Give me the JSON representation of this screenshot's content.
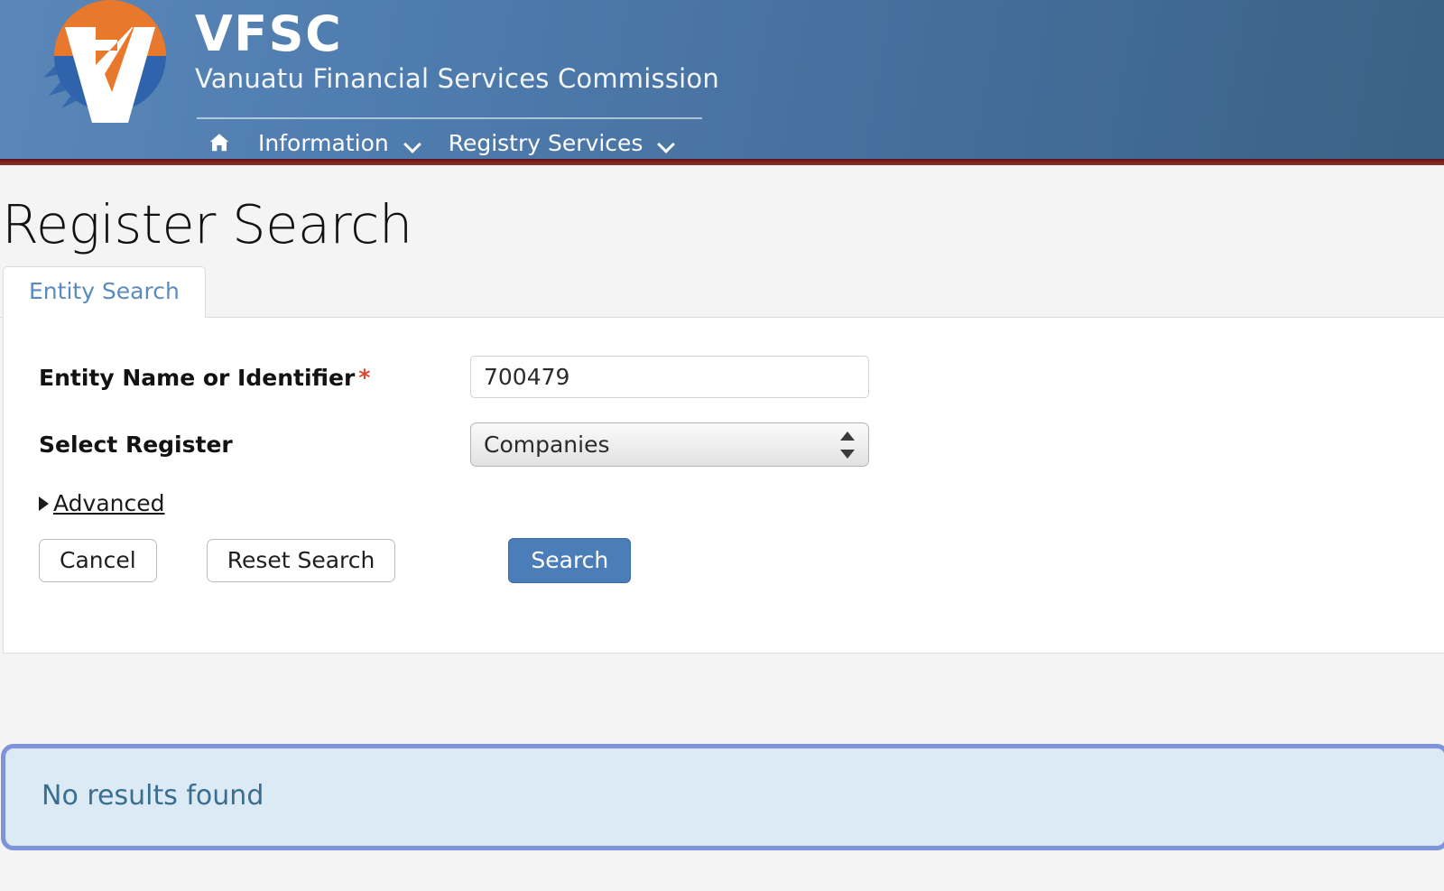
{
  "header": {
    "logo_icon": "vfsc-logo-icon",
    "brand_title": "VFSC",
    "brand_subtitle": "Vanuatu Financial Services Commission",
    "nav": [
      {
        "label": "",
        "icon": "home-icon",
        "has_chevron": false
      },
      {
        "label": "Information",
        "icon": "",
        "has_chevron": true
      },
      {
        "label": "Registry Services",
        "icon": "",
        "has_chevron": true
      }
    ],
    "colors": {
      "bg_left": "#5a86b8",
      "bg_right": "#3b6285",
      "accent_bar": "#7c2321"
    }
  },
  "page": {
    "title": "Register Search"
  },
  "tabs": [
    {
      "label": "Entity Search",
      "active": true
    }
  ],
  "form": {
    "entity_label": "Entity Name or Identifier",
    "entity_required_mark": "*",
    "entity_value": "700479",
    "entity_placeholder": "",
    "register_label": "Select Register",
    "register_value": "Companies",
    "register_options": [
      "Companies"
    ],
    "advanced_label": "Advanced",
    "advanced_arrow": "collapsed-triangle-icon",
    "buttons": {
      "cancel": "Cancel",
      "reset": "Reset Search",
      "search": "Search"
    },
    "colors": {
      "primary_button": "#4b7eb8",
      "required_star": "#e1482d",
      "tab_text": "#5a8bbd"
    }
  },
  "results": {
    "message": "No results found",
    "colors": {
      "border": "#7f93d8",
      "background": "#dceaf5",
      "text": "#3a6e8f"
    }
  }
}
